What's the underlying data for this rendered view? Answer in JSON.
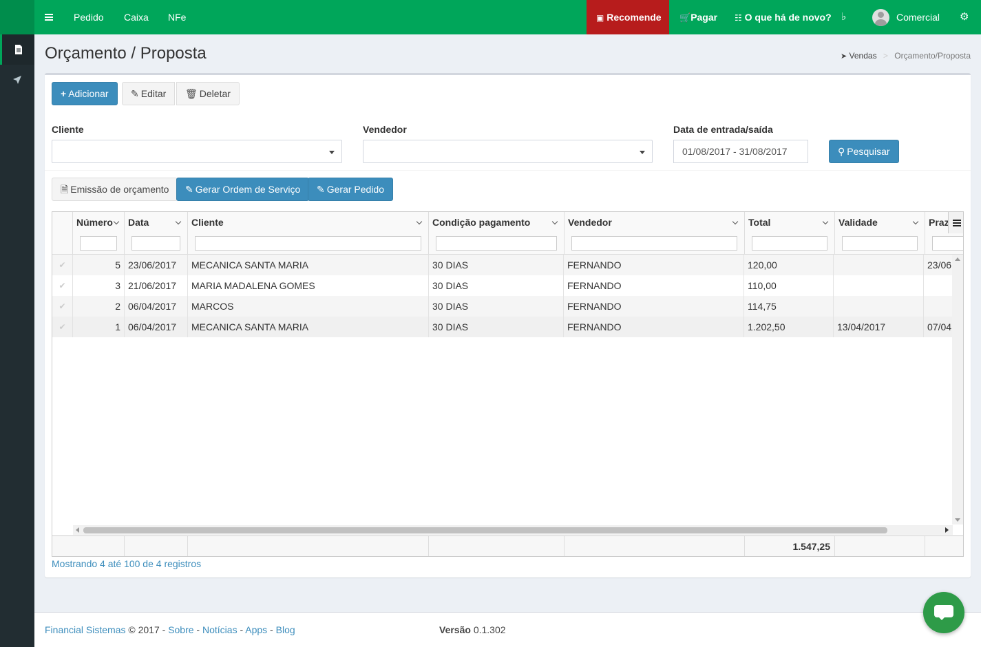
{
  "topbar": {
    "nav": [
      "Pedido",
      "Caixa",
      "NFe"
    ],
    "recomende": "Recomende",
    "pagar": "Pagar",
    "novidades": "O que há de novo?",
    "user": "Comercial"
  },
  "page": {
    "title": "Orçamento / Proposta",
    "breadcrumb_root": "Vendas",
    "breadcrumb_current": "Orçamento/Proposta"
  },
  "toolbar": {
    "add": "Adicionar",
    "edit": "Editar",
    "delete": "Deletar"
  },
  "filters": {
    "cliente_label": "Cliente",
    "vendedor_label": "Vendedor",
    "date_label": "Data de entrada/saída",
    "date_value": "01/08/2017 - 31/08/2017",
    "search": "Pesquisar"
  },
  "actions": {
    "emissao": "Emissão de orçamento",
    "gerar_os": "Gerar Ordem de Serviço",
    "gerar_pedido": "Gerar Pedido"
  },
  "grid": {
    "columns": [
      "Número",
      "Data",
      "Cliente",
      "Condição pagamento",
      "Vendedor",
      "Total",
      "Validade",
      "Praz"
    ],
    "rows": [
      {
        "numero": "5",
        "data": "23/06/2017",
        "cliente": "MECANICA SANTA MARIA",
        "condicao": "30 DIAS",
        "vendedor": "FERNANDO",
        "total": "120,00",
        "validade": "",
        "prazo": "23/06"
      },
      {
        "numero": "3",
        "data": "21/06/2017",
        "cliente": "MARIA MADALENA GOMES",
        "condicao": "30 DIAS",
        "vendedor": "FERNANDO",
        "total": "110,00",
        "validade": "",
        "prazo": ""
      },
      {
        "numero": "2",
        "data": "06/04/2017",
        "cliente": "MARCOS",
        "condicao": "30 DIAS",
        "vendedor": "FERNANDO",
        "total": "114,75",
        "validade": "",
        "prazo": ""
      },
      {
        "numero": "1",
        "data": "06/04/2017",
        "cliente": "MECANICA SANTA MARIA",
        "condicao": "30 DIAS",
        "vendedor": "FERNANDO",
        "total": "1.202,50",
        "validade": "13/04/2017",
        "prazo": "07/04"
      }
    ],
    "total_sum": "1.547,25",
    "records": "Mostrando 4 até 100 de 4 registros"
  },
  "footer": {
    "company": "Financial Sistemas",
    "copyright": "© 2017 -",
    "links": [
      "Sobre",
      "Notícias",
      "Apps",
      "Blog"
    ],
    "version_label": "Versão",
    "version": "0.1.302"
  },
  "colors": {
    "topbar": "#00a65a",
    "recomende": "#b71c1c",
    "sidebar": "#222d32",
    "primary": "#3c8dbc"
  }
}
